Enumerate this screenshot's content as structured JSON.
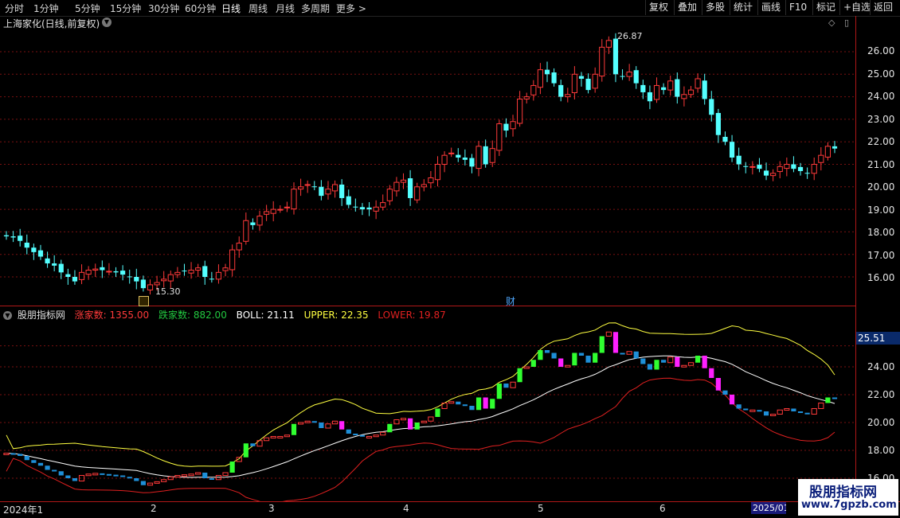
{
  "toolbar": {
    "periods": [
      "分时",
      "1分钟",
      "5分钟",
      "15分钟",
      "30分钟",
      "60分钟",
      "日线",
      "周线",
      "月线",
      "多周期",
      "更多 >"
    ],
    "active_period": "日线",
    "right_buttons": [
      "复权",
      "叠加",
      "多股",
      "统计",
      "画线",
      "F10",
      "标记",
      "+自选",
      "返回"
    ]
  },
  "main_chart": {
    "title": "上海家化(日线,前复权)",
    "high_label": "26.87",
    "low_label": "15.30",
    "cai_label": "财",
    "y_ticks": [
      "26.00",
      "25.00",
      "24.00",
      "23.00",
      "22.00",
      "21.00",
      "20.00",
      "19.00",
      "18.00",
      "17.00",
      "16.00"
    ],
    "icons": [
      "diamond-icon",
      "layout-icon"
    ]
  },
  "indicator": {
    "name": "股朋指标网",
    "up_label": "涨家数: 1355.00",
    "down_label": "跌家数: 882.00",
    "boll_label": "BOLL: 21.11",
    "upper_label": "UPPER: 22.35",
    "lower_label": "LOWER: 19.87",
    "boll_badge": "25.51",
    "y_ticks": [
      "24.00",
      "22.00",
      "20.00",
      "18.00",
      "16.00"
    ],
    "colors": {
      "up": "#ff3a3a",
      "down": "#22c840",
      "boll": "#ffffff",
      "upper": "#ffff40",
      "lower": "#e02020",
      "bar_blue": "#1e8fd8",
      "bar_magenta": "#ff20ff",
      "bar_green": "#30ff30"
    }
  },
  "x_axis": {
    "labels": [
      "2024年1",
      "2",
      "3",
      "4",
      "5",
      "6"
    ],
    "date_badge": "2025/01"
  },
  "watermark": {
    "title": "股朋指标网",
    "url": "www.7gpzb.com"
  },
  "chart_data": {
    "type": "candlestick",
    "title": "上海家化(日线,前复权)",
    "y_range": [
      15.3,
      26.87
    ],
    "closes": [
      17.8,
      17.75,
      17.6,
      17.3,
      17.1,
      16.9,
      16.6,
      16.5,
      16.2,
      16.0,
      15.8,
      16.2,
      16.3,
      16.35,
      16.3,
      16.25,
      16.2,
      16.1,
      16.0,
      15.8,
      15.5,
      15.65,
      15.75,
      15.9,
      16.1,
      16.2,
      16.25,
      16.3,
      16.4,
      16.0,
      15.9,
      16.2,
      16.4,
      17.2,
      17.5,
      18.5,
      18.3,
      18.7,
      18.9,
      19.0,
      19.0,
      19.1,
      19.9,
      20.0,
      20.1,
      20.0,
      19.6,
      19.9,
      20.1,
      19.5,
      19.2,
      19.1,
      19.0,
      19.0,
      19.1,
      19.3,
      19.9,
      20.2,
      20.3,
      19.5,
      20.0,
      20.1,
      20.4,
      21.0,
      21.4,
      21.5,
      21.3,
      21.2,
      20.9,
      21.8,
      21.0,
      21.7,
      22.8,
      22.5,
      22.9,
      23.9,
      24.0,
      24.5,
      25.2,
      25.0,
      24.6,
      24.0,
      24.1,
      25.0,
      24.8,
      24.3,
      25.0,
      26.2,
      26.5,
      25.0,
      24.9,
      25.1,
      24.6,
      24.2,
      23.8,
      24.5,
      24.3,
      24.7,
      24.0,
      24.1,
      24.3,
      24.8,
      23.9,
      23.2,
      22.3,
      22.0,
      21.3,
      21.0,
      20.9,
      20.9,
      20.8,
      20.5,
      20.6,
      20.9,
      21.0,
      20.8,
      20.7,
      20.6,
      21.0,
      21.4,
      21.8,
      21.7
    ]
  }
}
